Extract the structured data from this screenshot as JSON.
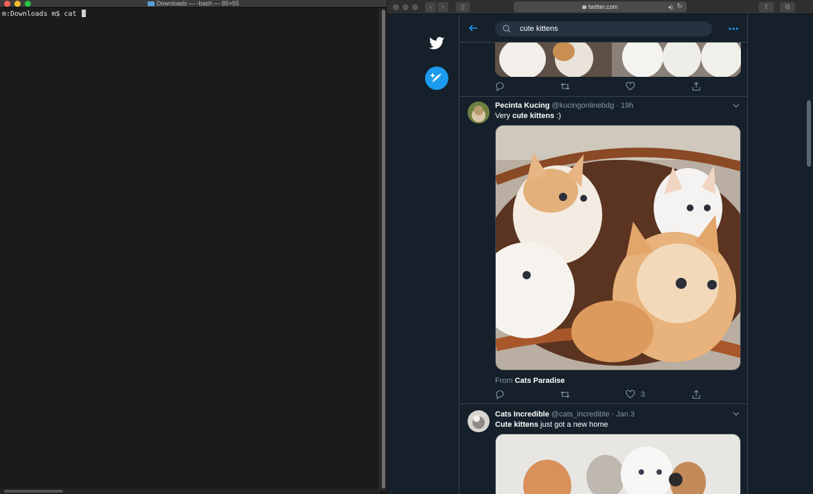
{
  "terminal": {
    "title": "Downloads — -bash — 85×55",
    "prompt": "m:Downloads m$ cat "
  },
  "browser": {
    "url": "twitter.com"
  },
  "twitter": {
    "search_query": "cute kittens",
    "tweets": [
      {
        "name": "Pecinta Kucing",
        "handle": "@kucingonlinebdg",
        "time": "· 19h",
        "text_prefix": "Very ",
        "text_bold": "cute kittens",
        "text_suffix": " :)",
        "from_prefix": "From ",
        "from_source": "Cats Paradise",
        "like_count": "3"
      },
      {
        "name": "Cats Incredible",
        "handle": "@cats_incredible",
        "time": "· Jan 3",
        "text_prefix": "",
        "text_bold": "Cute kittens",
        "text_suffix": " just got a new home"
      }
    ]
  },
  "colors": {
    "twitter_bg": "#15202b",
    "twitter_blue": "#1d9bf0",
    "secondary_text": "#8899a6",
    "border": "#38444d",
    "terminal_bg": "#1b1b1b"
  },
  "icons": [
    "twitter-bird-icon",
    "compose-icon",
    "back-arrow-icon",
    "search-icon",
    "more-icon",
    "reply-icon",
    "retweet-icon",
    "like-icon",
    "share-icon",
    "chevron-down-icon"
  ]
}
